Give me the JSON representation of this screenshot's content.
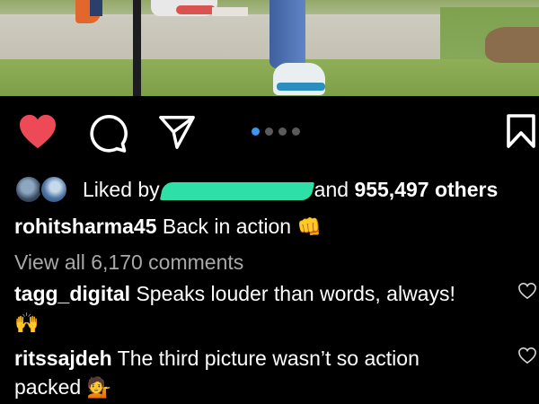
{
  "post": {
    "likes": {
      "prefix": "Liked by",
      "middle": "and",
      "count": "955,497 others"
    },
    "caption": {
      "username": "rohitsharma45",
      "text": "Back in action",
      "emoji": "👊"
    },
    "view_all_comments": "View all 6,170 comments",
    "comments": [
      {
        "username": "tagg_digital",
        "text": "Speaks louder than words, always!",
        "emoji": "🙌"
      },
      {
        "username": "ritssajdeh",
        "text": "The third picture wasn’t so action",
        "text_line2": "packed",
        "emoji": "💁"
      }
    ],
    "carousel": {
      "total": 4,
      "active_index": 0
    }
  },
  "colors": {
    "like_active": "#ed4956",
    "carousel_active": "#3897f0",
    "muted_text": "#a8a8a8",
    "redaction": "#2ee0a8"
  },
  "icons": [
    "heart-icon",
    "comment-icon",
    "share-icon",
    "bookmark-icon",
    "heart-outline-icon"
  ]
}
